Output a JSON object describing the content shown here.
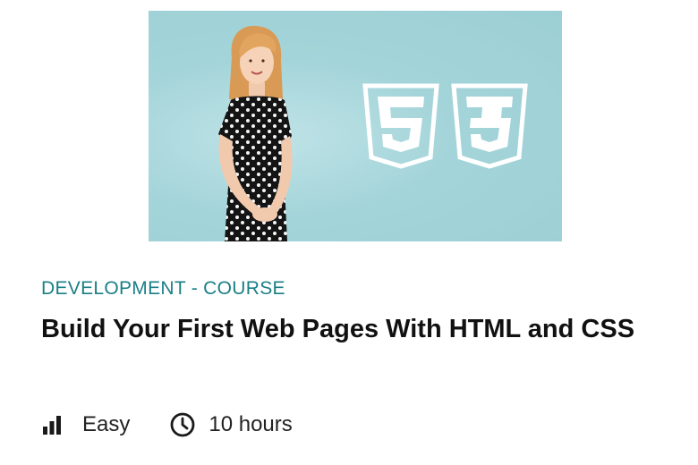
{
  "course": {
    "thumbnail": {
      "background": "#9ccfd4",
      "badges": [
        {
          "icon": "html5-shield-icon",
          "glyph": "5"
        },
        {
          "icon": "css3-shield-icon",
          "glyph": "3"
        }
      ]
    },
    "category": "DEVELOPMENT - COURSE",
    "title": "Build Your First Web Pages With HTML and CSS",
    "difficulty": {
      "icon": "difficulty-bars-icon",
      "label": "Easy"
    },
    "duration": {
      "icon": "clock-icon",
      "label": "10 hours"
    },
    "accent_color": "#1b7f86"
  }
}
